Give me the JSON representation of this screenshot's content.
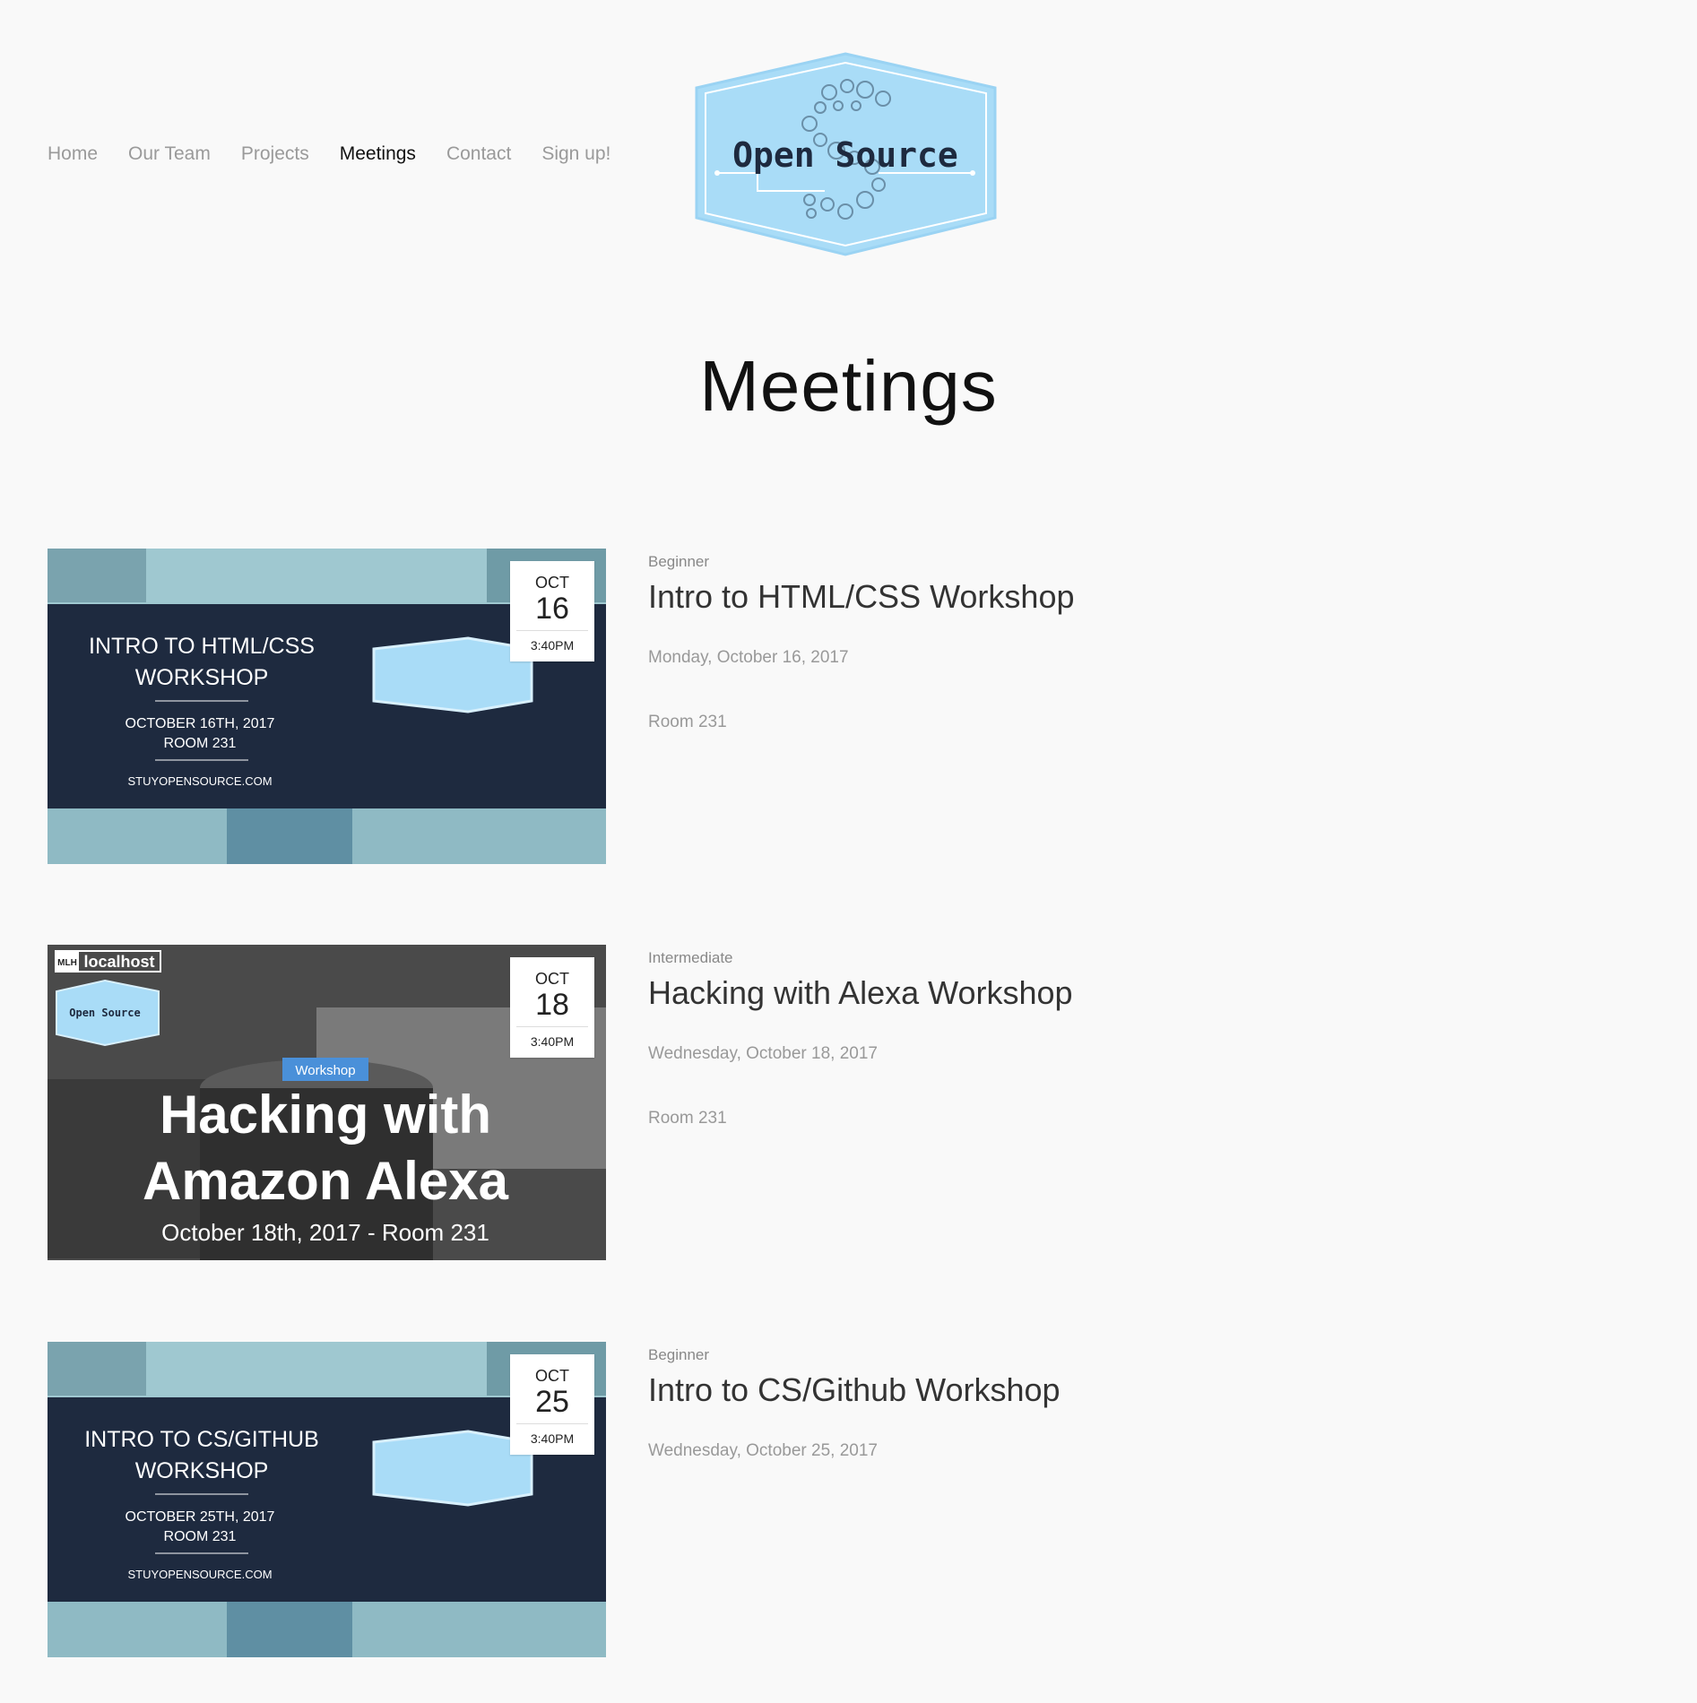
{
  "nav": {
    "items": [
      "Home",
      "Our Team",
      "Projects",
      "Meetings",
      "Contact",
      "Sign up!"
    ],
    "active": "Meetings"
  },
  "logo": {
    "text": "Open Source"
  },
  "page_title": "Meetings",
  "colors": {
    "background": "#f9f9f9",
    "logo_fill": "#a9dcf7",
    "banner_navy": "#1e2a3f",
    "workshop_tag": "#4a90d9"
  },
  "meetings": [
    {
      "level": "Beginner",
      "title": "Intro to HTML/CSS Workshop",
      "date": "Monday, October 16, 2017",
      "room": "Room 231",
      "badge": {
        "month": "OCT",
        "day": "16",
        "time": "3:40PM"
      },
      "image": {
        "line1": "INTRO TO HTML/CSS",
        "line2": "WORKSHOP",
        "date": "OCTOBER 16TH, 2017",
        "room": "ROOM 231",
        "site": "STUYOPENSOURCE.COM"
      }
    },
    {
      "level": "Intermediate",
      "title": "Hacking with Alexa Workshop",
      "date": "Wednesday, October 18, 2017",
      "room": "Room 231",
      "badge": {
        "month": "OCT",
        "day": "18",
        "time": "3:40PM"
      },
      "image": {
        "mlh": "MLH",
        "localhost": "localhost",
        "logo_text": "Open Source",
        "tag": "Workshop",
        "line1": "Hacking with",
        "line2": "Amazon Alexa",
        "footer": "October 18th, 2017 - Room 231"
      }
    },
    {
      "level": "Beginner",
      "title": "Intro to CS/Github Workshop",
      "date": "Wednesday, October 25, 2017",
      "room": "",
      "badge": {
        "month": "OCT",
        "day": "25",
        "time": "3:40PM"
      },
      "image": {
        "line1": "INTRO TO CS/GITHUB",
        "line2": "WORKSHOP",
        "date": "OCTOBER 25TH, 2017",
        "room": "ROOM 231",
        "site": "STUYOPENSOURCE.COM"
      }
    }
  ]
}
